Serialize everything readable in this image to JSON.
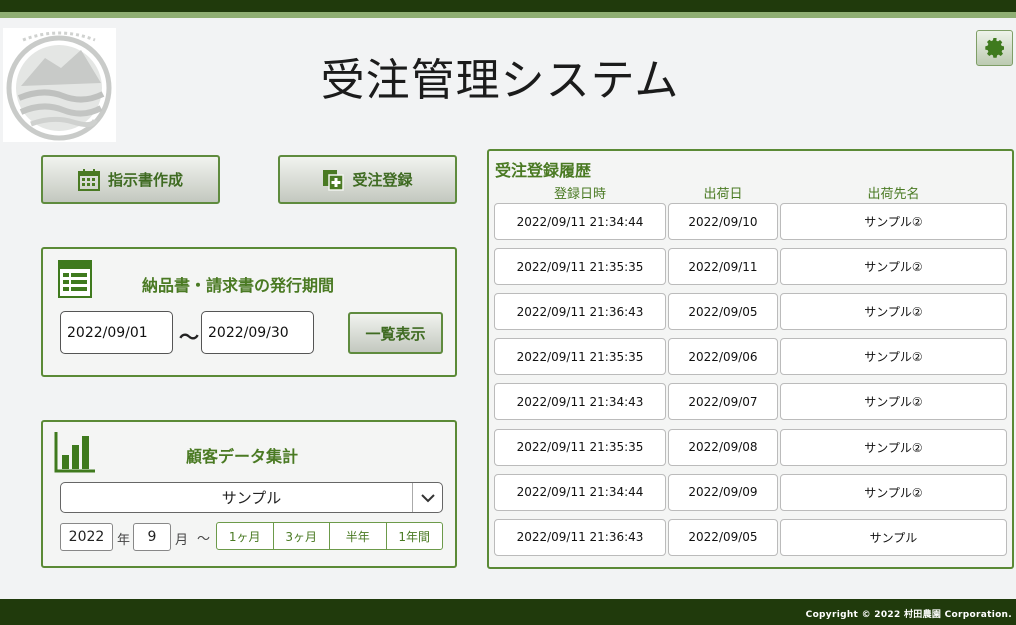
{
  "app": {
    "title": "受注管理システム"
  },
  "header": {
    "settings_icon": "gear-icon"
  },
  "actions": {
    "instruction_label": "指示書作成",
    "order_register_label": "受注登録"
  },
  "issue_period": {
    "title": "納品書・請求書の発行期間",
    "from": "2022/09/01",
    "separator": "～",
    "to": "2022/09/30",
    "list_button": "一覧表示"
  },
  "customer_summary": {
    "title": "顧客データ集計",
    "selected_customer": "サンプル",
    "year": "2022",
    "year_unit": "年",
    "month": "9",
    "month_unit": "月",
    "range_sep": "～",
    "ranges": [
      "1ヶ月",
      "3ヶ月",
      "半年",
      "1年間"
    ]
  },
  "history": {
    "title": "受注登録履歴",
    "columns": [
      "登録日時",
      "出荷日",
      "出荷先名"
    ],
    "rows": [
      [
        "2022/09/11 21:34:44",
        "2022/09/10",
        "サンプル②"
      ],
      [
        "2022/09/11 21:35:35",
        "2022/09/11",
        "サンプル②"
      ],
      [
        "2022/09/11 21:36:43",
        "2022/09/05",
        "サンプル②"
      ],
      [
        "2022/09/11 21:35:35",
        "2022/09/06",
        "サンプル②"
      ],
      [
        "2022/09/11 21:34:43",
        "2022/09/07",
        "サンプル②"
      ],
      [
        "2022/09/11 21:35:35",
        "2022/09/08",
        "サンプル②"
      ],
      [
        "2022/09/11 21:34:44",
        "2022/09/09",
        "サンプル②"
      ],
      [
        "2022/09/11 21:36:43",
        "2022/09/05",
        "サンプル"
      ]
    ]
  },
  "footer": {
    "copyright": "Copyright © 2022 村田農園 Corporation."
  },
  "colors": {
    "brand_dark": "#203a0c",
    "accent_green": "#4a7a23",
    "border_green": "#5b8a36"
  }
}
